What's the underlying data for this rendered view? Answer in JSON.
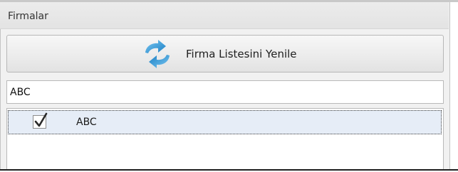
{
  "panel": {
    "title": "Firmalar"
  },
  "refresh_button": {
    "label": "Firma Listesini Yenile",
    "icon": "refresh-arrows-icon"
  },
  "search": {
    "value": "ABC"
  },
  "company_list": {
    "items": [
      {
        "label": "ABC",
        "checked": true
      }
    ]
  },
  "colors": {
    "refresh_icon_blue": "#1f8fd6",
    "selected_row_background": "#e6edf7",
    "panel_background": "#f1f1f1"
  }
}
